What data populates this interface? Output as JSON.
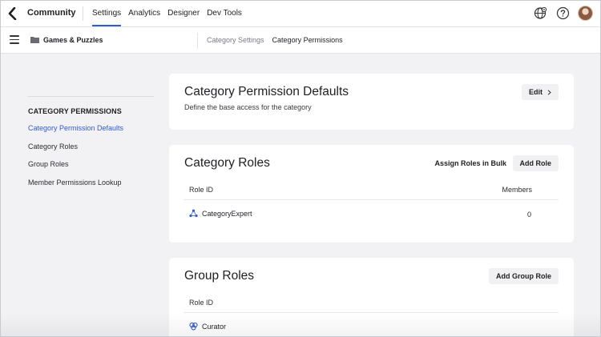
{
  "app": {
    "name": "Community"
  },
  "top_nav": [
    {
      "label": "Settings",
      "active": true
    },
    {
      "label": "Analytics",
      "active": false
    },
    {
      "label": "Designer",
      "active": false
    },
    {
      "label": "Dev Tools",
      "active": false
    }
  ],
  "top_icons": [
    "globe-settings-icon",
    "help-icon",
    "avatar"
  ],
  "subbar": {
    "category": "Games & Puzzles",
    "tabs": [
      {
        "label": "Category Settings",
        "active": false
      },
      {
        "label": "Category Permissions",
        "active": true
      }
    ]
  },
  "leftnav": {
    "heading": "CATEGORY PERMISSIONS",
    "items": [
      {
        "label": "Category Permission Defaults",
        "active": true
      },
      {
        "label": "Category Roles",
        "active": false
      },
      {
        "label": "Group Roles",
        "active": false
      },
      {
        "label": "Member Permissions Lookup",
        "active": false
      }
    ]
  },
  "defaults_card": {
    "title": "Category Permission Defaults",
    "description": "Define the base access for the category",
    "edit_label": "Edit"
  },
  "roles_card": {
    "title": "Category Roles",
    "assign_bulk_label": "Assign Roles in Bulk",
    "add_role_label": "Add Role",
    "columns": [
      "Role ID",
      "Members"
    ],
    "rows": [
      {
        "role_id": "CategoryExpert",
        "members": "0"
      }
    ]
  },
  "group_roles_card": {
    "title": "Group Roles",
    "add_group_role_label": "Add Group Role",
    "columns": [
      "Role ID"
    ],
    "rows": [
      {
        "role_id": "Curator"
      }
    ]
  },
  "colors": {
    "accent": "#2f5bd1",
    "background": "#f2f2f4",
    "card": "#ffffff"
  }
}
